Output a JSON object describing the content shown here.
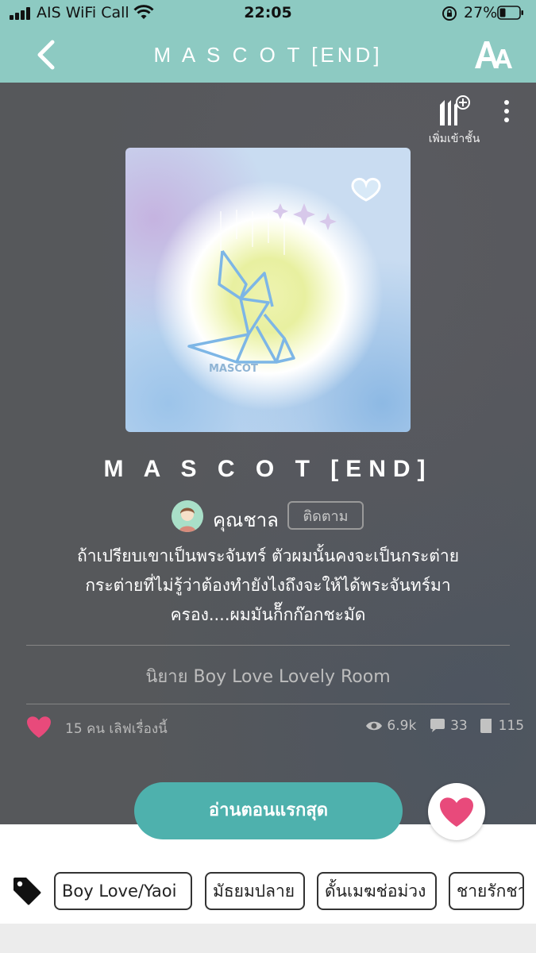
{
  "status_bar": {
    "carrier": "AIS WiFi Call",
    "time": "22:05",
    "battery": "27%"
  },
  "header": {
    "title": "M A S C O T [END]"
  },
  "actions": {
    "add_shelf_label": "เพิ่มเข้าชั้น"
  },
  "novel": {
    "title": "M A S C O T [END]",
    "author": "คุณชาล",
    "follow_label": "ติดตาม",
    "description_lines": [
      "ถ้าเปรียบเขาเป็นพระจันทร์ ตัวผมนั้นคงจะเป็นกระต่าย",
      "กระต่ายที่ไม่รู้ว่าต้องทำยังไงถึงจะให้ได้พระจันทร์มา",
      "ครอง....ผมมันก็๊กก๊อกชะมัด"
    ],
    "category": "นิยาย Boy Love Lovely Room",
    "favorites_text": "15 คน เลิฟเรื่องนี้",
    "views": "6.9k",
    "comments": "33",
    "chapters": "115",
    "cover_caption": "MASCOT"
  },
  "cta": {
    "read_first": "อ่านตอนแรกสุด"
  },
  "tags": [
    "Boy Love/Yaoi",
    "มัธยมปลาย",
    "ดั้นเมฆช่อม่วง",
    "ชายรักชาย"
  ],
  "colors": {
    "header_bg": "#8dcac2",
    "cta_bg": "#4eb1ad",
    "heart": "#e84a7b"
  }
}
